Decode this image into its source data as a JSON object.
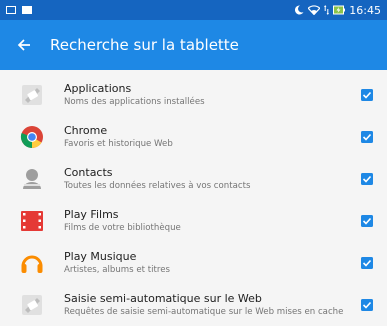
{
  "status_bar": {
    "time": "16:45"
  },
  "toolbar": {
    "title": "Recherche sur la tablette"
  },
  "items": [
    {
      "title": "Applications",
      "subtitle": "Noms des applications installées",
      "icon": "android-apps-icon",
      "checked": true
    },
    {
      "title": "Chrome",
      "subtitle": "Favoris et historique Web",
      "icon": "chrome-icon",
      "checked": true
    },
    {
      "title": "Contacts",
      "subtitle": "Toutes les données relatives à vos contacts",
      "icon": "contacts-icon",
      "checked": true
    },
    {
      "title": "Play Films",
      "subtitle": "Films de votre bibliothèque",
      "icon": "play-films-icon",
      "checked": true
    },
    {
      "title": "Play Musique",
      "subtitle": "Artistes, albums et titres",
      "icon": "play-music-icon",
      "checked": true
    },
    {
      "title": "Saisie semi-automatique sur le Web",
      "subtitle": "Requêtes de saisie semi-automatique sur le Web mises en cache",
      "icon": "android-web-icon",
      "checked": true
    }
  ],
  "colors": {
    "status_bar": "#1565c0",
    "toolbar": "#1e88e5",
    "checkbox": "#1e88e5"
  }
}
